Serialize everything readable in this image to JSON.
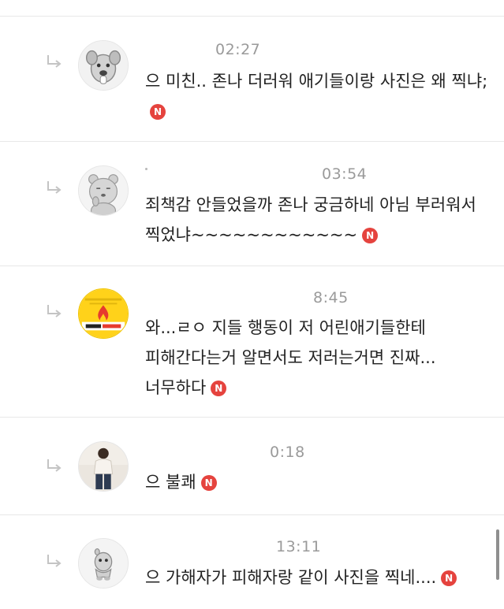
{
  "comments": [
    {
      "time": "02:27",
      "text": "으 미친.. 존나 더러워 애기들이랑 사진은 왜 찍냐;",
      "badge": "N",
      "avatar_icon": "gray-dog-character-avatar"
    },
    {
      "time": "03:54",
      "text": "죄책감 안들었을까 존나 궁금하네 아님 부러워서 찍었냐~~~~~~~~~~~~",
      "badge": "N",
      "avatar_icon": "gray-bear-character-avatar"
    },
    {
      "time": "8:45",
      "text": "와...ㄹㅇ 지들 행동이 저 어린애기들한테 피해간다는거 알면서도 저러는거면 진짜...너무하다",
      "badge": "N",
      "avatar_icon": "candle-logo-avatar"
    },
    {
      "time": "0:18",
      "text": "으 불쾌",
      "badge": "N",
      "avatar_icon": "person-photo-avatar"
    },
    {
      "time": "13:11",
      "text": "으 가해자가 피해자랑 같이 사진을 찍네....",
      "badge": "N",
      "avatar_icon": "gray-creature-character-avatar"
    }
  ],
  "colors": {
    "badge": "#e5433e",
    "time": "#9a9a9a",
    "text": "#222222",
    "divider": "#e8e8e8"
  }
}
